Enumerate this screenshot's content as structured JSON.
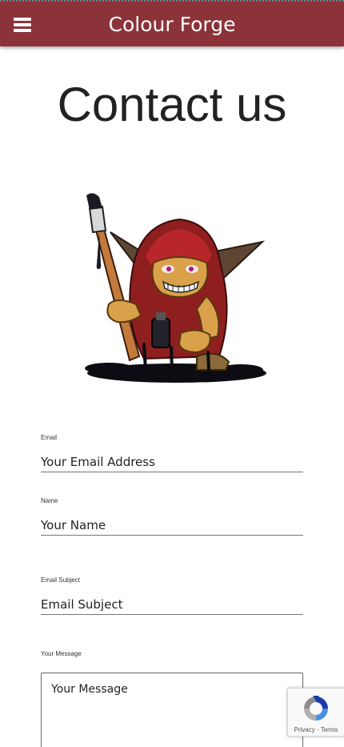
{
  "header": {
    "brand": "Colour Forge",
    "background": "#8c3339"
  },
  "page": {
    "title": "Contact us"
  },
  "form": {
    "email": {
      "label": "Email",
      "placeholder": "Your Email Address"
    },
    "name": {
      "label": "Name",
      "placeholder": "Your Name"
    },
    "subject": {
      "label": "Email Subject",
      "placeholder": "Email Subject"
    },
    "message": {
      "label": "Your Message",
      "placeholder": "Your Message"
    }
  },
  "recaptcha": {
    "privacy": "Privacy",
    "separator": "-",
    "terms": "Terms"
  },
  "icons": {
    "menu": "hamburger-menu-icon",
    "mascot": "goblin-painter-illustration",
    "recaptcha": "recaptcha-logo-icon"
  }
}
